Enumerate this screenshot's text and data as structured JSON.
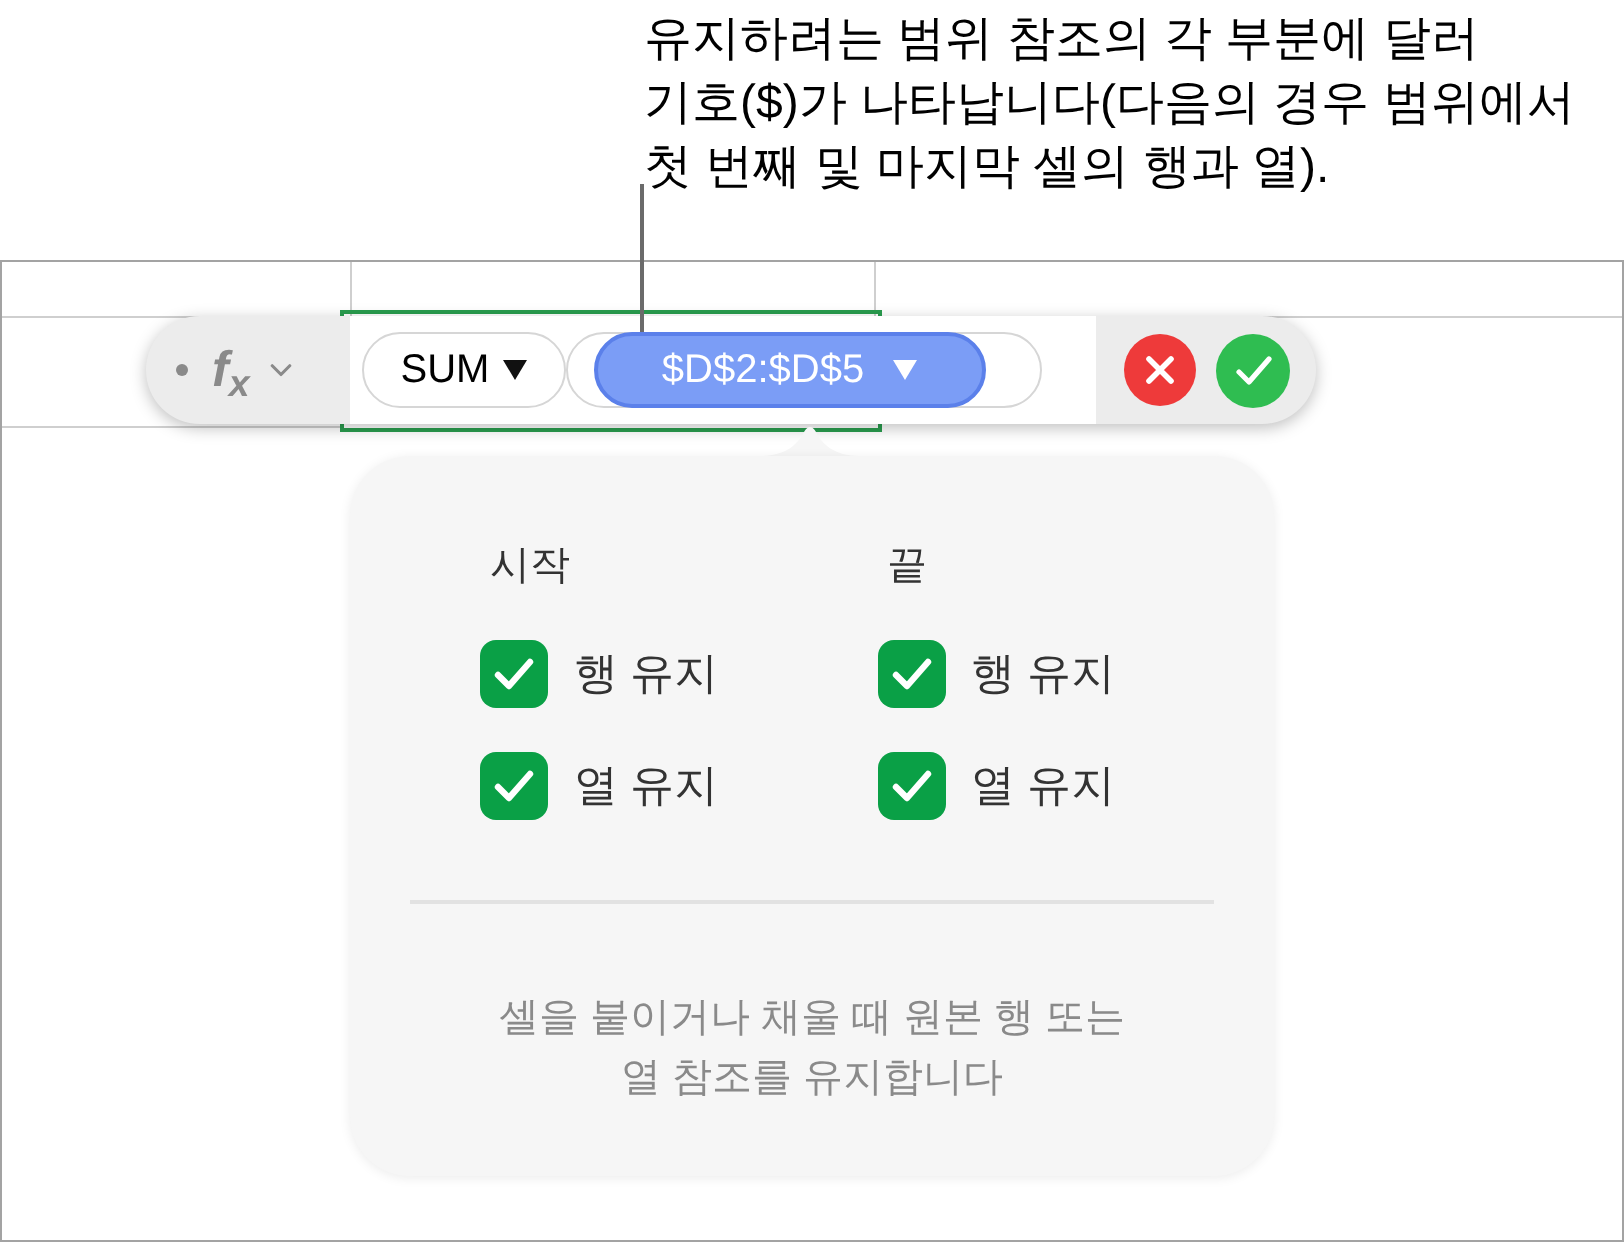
{
  "callout": {
    "lines": [
      "유지하려는 범위 참조의 각 부분에 달러",
      "기호($)가 나타납니다(다음의 경우 범위에서",
      "첫 번째 및 마지막 셀의 행과 열)."
    ]
  },
  "formula_bar": {
    "formula_icon": "f$_{x}$",
    "function": "SUM",
    "range": "$D$2:$D$5"
  },
  "popover": {
    "groups": [
      {
        "heading": "시작",
        "options": [
          {
            "label": "행 유지",
            "checked": true
          },
          {
            "label": "열 유지",
            "checked": true
          }
        ]
      },
      {
        "heading": "끝",
        "options": [
          {
            "label": "행 유지",
            "checked": true
          },
          {
            "label": "열 유지",
            "checked": true
          }
        ]
      }
    ],
    "note": {
      "lines": [
        "셀을 붙이거나 채울 때 원본 행 또는",
        "열 참조를 유지합니다"
      ]
    }
  }
}
